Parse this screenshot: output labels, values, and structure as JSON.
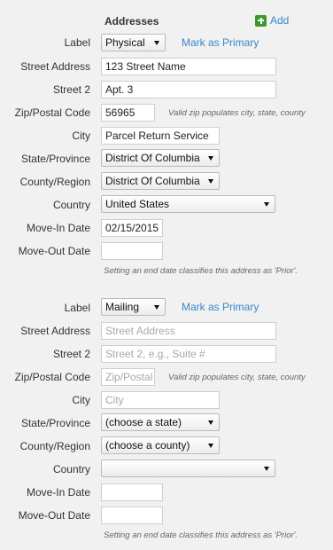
{
  "section_title": "Addresses",
  "add_label": "Add",
  "labels": {
    "label": "Label",
    "street_address": "Street Address",
    "street2": "Street 2",
    "zip": "Zip/Postal Code",
    "city": "City",
    "state": "State/Province",
    "county": "County/Region",
    "country": "Country",
    "move_in": "Move-In Date",
    "move_out": "Move-Out Date"
  },
  "mark_primary": "Mark as Primary",
  "zip_hint": "Valid zip populates city, state, county",
  "end_date_hint": "Setting an end date classifies this address as 'Prior'.",
  "address1": {
    "label_select": "Physical",
    "street_address": "123 Street Name",
    "street2": "Apt. 3",
    "zip": "56965",
    "city": "Parcel Return Service",
    "state": "District Of Columbia",
    "county": "District Of Columbia",
    "country": "United States",
    "move_in": "02/15/2015",
    "move_out": ""
  },
  "address2": {
    "label_select": "Mailing",
    "street_address_placeholder": "Street Address",
    "street2_placeholder": "Street 2, e.g., Suite #",
    "zip_placeholder": "Zip/Postal",
    "city_placeholder": "City",
    "state": "(choose a state)",
    "county": "(choose a county)",
    "country": "",
    "move_in": "",
    "move_out": ""
  }
}
